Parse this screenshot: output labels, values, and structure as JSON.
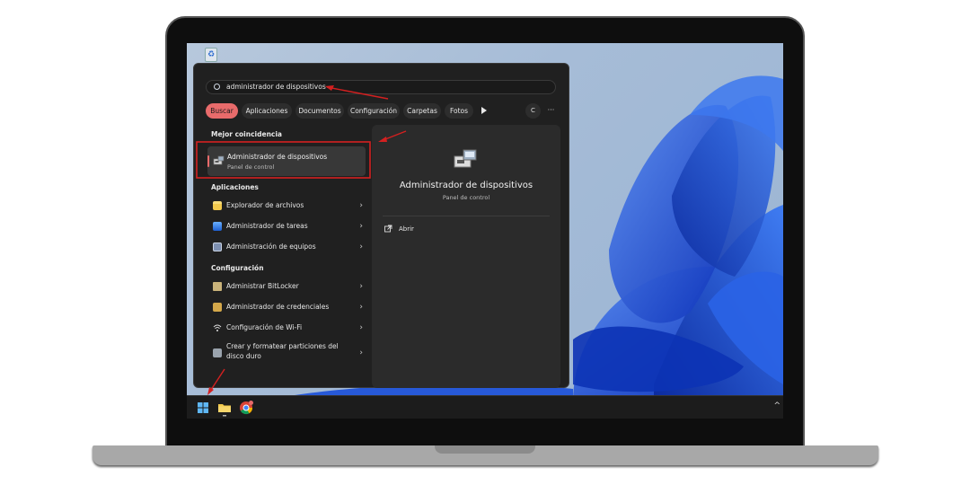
{
  "search": {
    "query": "administrador de dispositivos"
  },
  "filters": [
    "Buscar",
    "Aplicaciones",
    "Documentos",
    "Configuración",
    "Carpetas",
    "Fotos"
  ],
  "filter_buttons": {
    "account": "C",
    "more": "···"
  },
  "best_match": {
    "heading": "Mejor coincidencia",
    "title": "Administrador de dispositivos",
    "subtitle": "Panel de control"
  },
  "apps": {
    "heading": "Aplicaciones",
    "items": [
      "Explorador de archivos",
      "Administrador de tareas",
      "Administración de equipos"
    ]
  },
  "settings": {
    "heading": "Configuración",
    "items": [
      "Administrar BitLocker",
      "Administrador de credenciales",
      "Configuración de Wi-Fi",
      "Crear y formatear particiones del disco duro"
    ]
  },
  "detail": {
    "title": "Administrador de dispositivos",
    "subtitle": "Panel de control",
    "action": "Abrir"
  },
  "icons": {
    "search": "search-icon",
    "device_manager": "device-manager-icon",
    "open": "open-external-icon",
    "chevron": "chevron-right-icon",
    "start": "windows-start-icon",
    "explorer": "folder-icon",
    "chrome": "chrome-icon"
  },
  "colors": {
    "accent": "#e86b6b",
    "panel": "#202020",
    "annotation": "#d42020",
    "wallpaper_blue": "#1a4fd8"
  },
  "tray": {
    "chevron": "^"
  }
}
